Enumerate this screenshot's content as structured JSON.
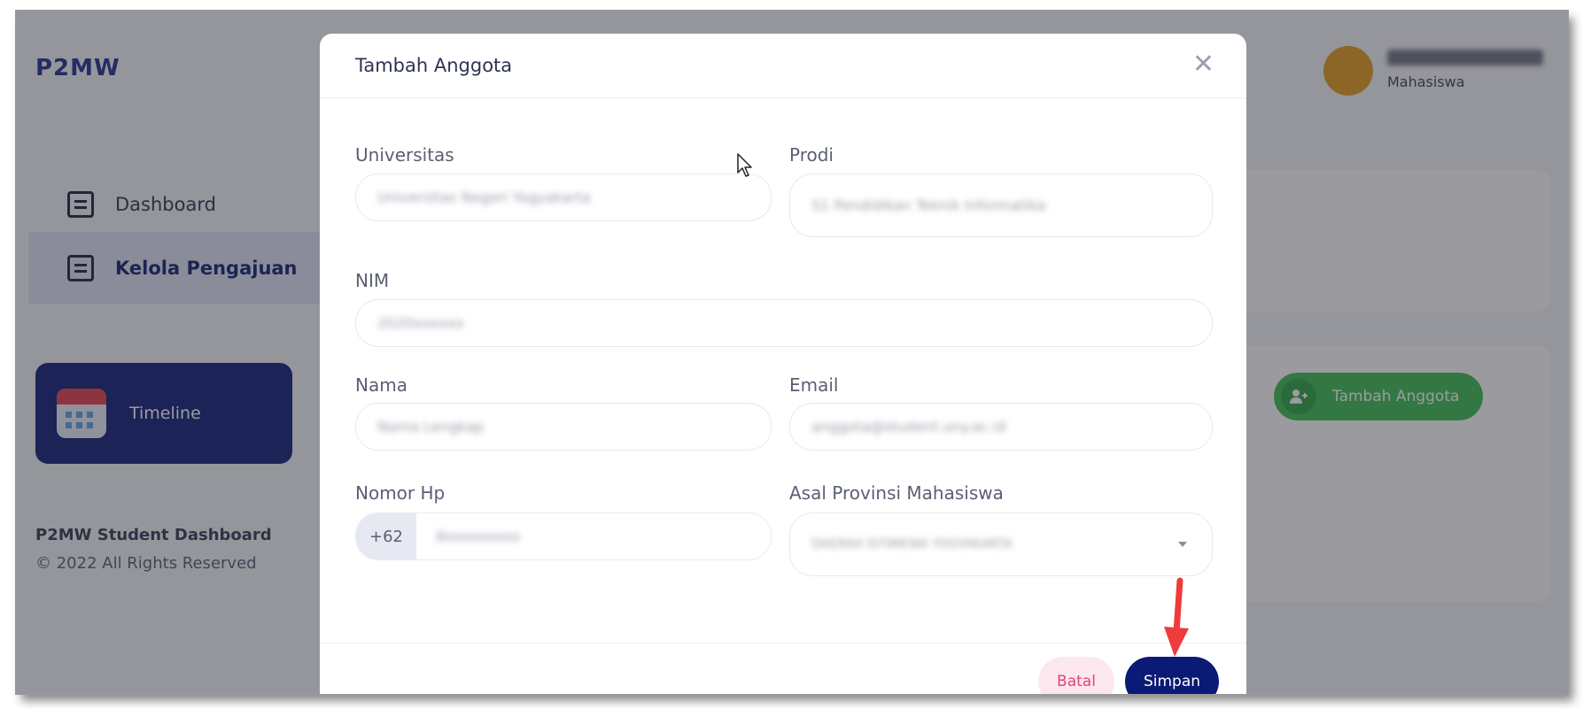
{
  "app": {
    "logo_text": "P2MW"
  },
  "sidebar": {
    "items": [
      {
        "label": "Dashboard",
        "icon": "dashboard-icon"
      },
      {
        "label": "Kelola Pengajuan",
        "icon": "clipboard-icon"
      }
    ],
    "timeline_label": "Timeline",
    "footer_title": "P2MW Student Dashboard",
    "footer_copy": "© 2022 All Rights Reserved"
  },
  "user": {
    "role": "Mahasiswa"
  },
  "background": {
    "add_member_button": "Tambah Anggota"
  },
  "modal": {
    "title": "Tambah Anggota",
    "close_icon": "close-icon",
    "fields": {
      "universitas": {
        "label": "Universitas",
        "value": "Universitas Negeri Yogyakarta"
      },
      "prodi": {
        "label": "Prodi",
        "value": "S1 Pendidikan Teknik Informatika"
      },
      "nim": {
        "label": "NIM",
        "value": "2020xxxxxx"
      },
      "nama": {
        "label": "Nama",
        "value": "Nama Lengkap"
      },
      "email": {
        "label": "Email",
        "value": "anggota@student.uny.ac.id"
      },
      "nomor_hp": {
        "label": "Nomor Hp",
        "prefix": "+62",
        "value": "8xxxxxxxxx"
      },
      "provinsi": {
        "label": "Asal Provinsi Mahasiswa",
        "value": "DAERAH ISTIMEWA YOGYAKARTA"
      }
    },
    "cancel_label": "Batal",
    "save_label": "Simpan"
  },
  "colors": {
    "primary": "#0a1a75",
    "success": "#39bd4f",
    "danger_soft": "#fde7ef",
    "annotation_arrow": "#ee3b3b"
  }
}
